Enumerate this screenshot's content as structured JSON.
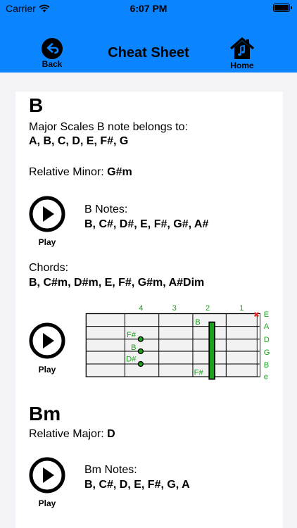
{
  "status": {
    "carrier": "Carrier",
    "time": "6:07 PM"
  },
  "header": {
    "title": "Cheat Sheet",
    "back_label": "Back",
    "home_label": "Home"
  },
  "b": {
    "heading": "B",
    "major_label": "Major Scales B note belongs to:",
    "major_values": "A, B, C, D, E, F#, G",
    "relative_minor_label": "Relative Minor:",
    "relative_minor_value": "G#m",
    "notes_label": "B Notes:",
    "notes_values": "B, C#, D#, E, F#, G#, A#",
    "play_label": "Play",
    "chords_label": "Chords:",
    "chords_values": "B, C#m, D#m, E, F#, G#m, A#Dim",
    "fretboard_play_label": "Play"
  },
  "fretboard": {
    "fret_numbers": [
      "4",
      "3",
      "2",
      "1"
    ],
    "string_names": [
      "E",
      "A",
      "D",
      "G",
      "B",
      "e"
    ],
    "note_labels": [
      "B",
      "F#",
      "B",
      "D#",
      "F#"
    ],
    "muted_marker": "✖",
    "accent": "#1aa31a"
  },
  "bm": {
    "heading": "Bm",
    "relative_major_label": "Relative Major:",
    "relative_major_value": "D",
    "notes_label": "Bm Notes:",
    "notes_values": "B, C#, D, E, F#, G, A",
    "play_label": "Play"
  }
}
